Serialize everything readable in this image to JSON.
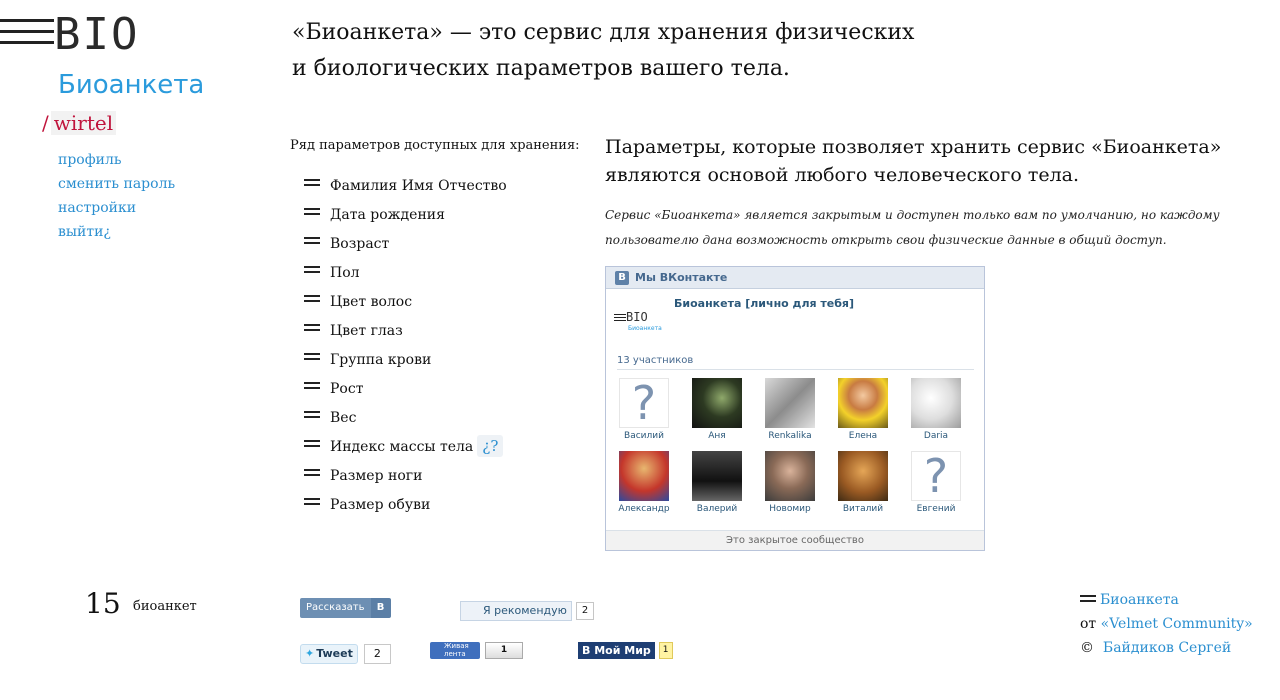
{
  "logo": {
    "text": "BIO",
    "brand": "Биоанкета"
  },
  "user": {
    "prefix": "/",
    "name": "wirtel"
  },
  "user_nav": [
    {
      "label": "профиль"
    },
    {
      "label": "сменить пароль"
    },
    {
      "label": "настройки"
    },
    {
      "label": "выйти¿"
    }
  ],
  "intro": "«Биоанкета» — это сервис для хранения физических и биологических параметров вашего тела.",
  "params": {
    "title": "Ряд параметров доступных для хранения:",
    "items": [
      "Фамилия Имя Отчество",
      "Дата рождения",
      "Возраст",
      "Пол",
      "Цвет волос",
      "Цвет глаз",
      "Группа крови",
      "Рост",
      "Вес",
      "Индекс массы тела",
      "Размер ноги",
      "Размер обуви"
    ],
    "bmi_help": "¿?"
  },
  "description": {
    "title": "Параметры, которые позволяет хранить сервис «Биоанкета» являются основой любого человеческого тела.",
    "note": "Сервис «Биоанкета» является закрытым и доступен только вам по умолчанию, но каждому пользователю дана возможность открыть свои физические данные в общий доступ."
  },
  "vk_widget": {
    "header": "Мы ВКонтакте",
    "header_icon": "В",
    "mini_logo_text": "BIO",
    "mini_logo_brand": "Биоанкета",
    "group_name": "Биоанкета [лично для тебя]",
    "members_count": "13 участников",
    "members": [
      {
        "name": "Василий",
        "photo": "question"
      },
      {
        "name": "Аня",
        "photo": "dark-green"
      },
      {
        "name": "Renkalika",
        "photo": "grey"
      },
      {
        "name": "Елена",
        "photo": "sunflower"
      },
      {
        "name": "Daria",
        "photo": "light"
      },
      {
        "name": "Александр",
        "photo": "superhero"
      },
      {
        "name": "Валерий",
        "photo": "car"
      },
      {
        "name": "Новомир",
        "photo": "face"
      },
      {
        "name": "Виталий",
        "photo": "warm"
      },
      {
        "name": "Евгений",
        "photo": "question"
      }
    ],
    "question_glyph": "?",
    "footer": "Это закрытое сообщество"
  },
  "stats": {
    "count": "15",
    "label": "биоанкет"
  },
  "share": {
    "vk_share": {
      "label": "Рассказать",
      "icon": "В"
    },
    "recommend": {
      "label": "Я рекомендую",
      "count": "2"
    },
    "tweet": {
      "label": "Tweet",
      "count": "2"
    },
    "livejournal": {
      "label": "Живая лента",
      "count": "1"
    },
    "moymir": {
      "label": "В Мой Мир",
      "count": "1"
    }
  },
  "credits": {
    "site": "Биоанкета",
    "from_prefix": "от",
    "community": "«Velmet Community»",
    "copyright": "©",
    "author": "Байдиков Сергей"
  }
}
